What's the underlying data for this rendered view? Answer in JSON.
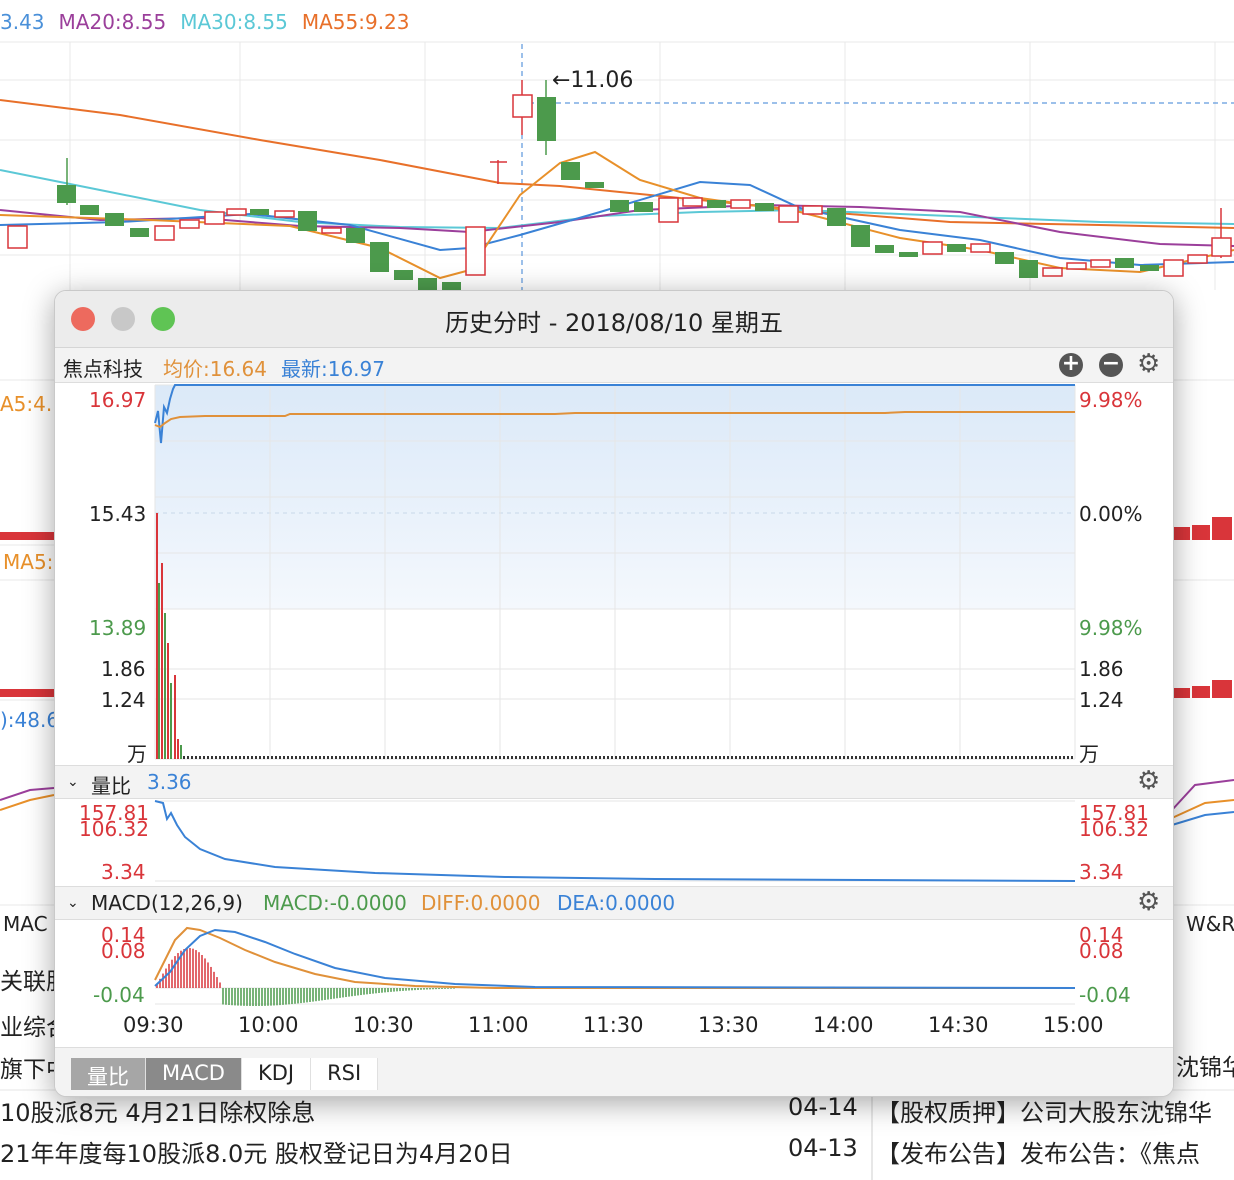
{
  "background": {
    "ma_legend": [
      {
        "text": "3.43",
        "color": "#4a90d9"
      },
      {
        "text": "MA20:8.55",
        "color": "#9b3f9b"
      },
      {
        "text": "MA30:8.55",
        "color": "#5bc8d6"
      },
      {
        "text": "MA55:9.23",
        "color": "#e8702a"
      }
    ],
    "peak_label": "←11.06",
    "left_labels": {
      "ma5_a": "A5:4.",
      "ma5_b": "MA5:",
      "val": "):48.6",
      "mac": "MAC",
      "related": "关联股",
      "industry": "业综合",
      "flag": "旗下中"
    },
    "right_labels": {
      "wr": "W&R",
      "shen": "沈锦华"
    },
    "news": [
      {
        "left": "10股派8元 4月21日除权除息",
        "date": "04-14",
        "right": "【股权质押】公司大股东沈锦华"
      },
      {
        "left": "21年年度每10股派8.0元 股权登记日为4月20日",
        "date": "04-13",
        "right": "【发布公告】发布公告：《焦点"
      }
    ],
    "candle_up_color": "#d9353a",
    "candle_down_color": "#4c9a4c"
  },
  "window": {
    "title": "历史分时 - 2018/08/10 星期五",
    "stock_name": "焦点科技",
    "avg_price": "均价:16.64",
    "latest": "最新:16.97",
    "price_axis_left": [
      "16.97",
      "15.43",
      "13.89"
    ],
    "price_axis_right": [
      "9.98%",
      "0.00%",
      "9.98%"
    ],
    "vol_axis": [
      "1.86",
      "1.24",
      "万"
    ],
    "time_axis": [
      "09:30",
      "10:00",
      "10:30",
      "11:00",
      "11:30",
      "13:30",
      "14:00",
      "14:30",
      "15:00"
    ],
    "ratio_section": {
      "label": "量比",
      "value": "3.36",
      "axis": [
        "157.81",
        "106.32",
        "3.34"
      ]
    },
    "macd_section": {
      "label": "MACD(12,26,9)",
      "macd": "MACD:-0.0000",
      "diff": "DIFF:0.0000",
      "dea": "DEA:0.0000",
      "axis": [
        "0.14",
        "0.08",
        "-0.04"
      ]
    },
    "tabs": [
      "量比",
      "MACD",
      "KDJ",
      "RSI"
    ],
    "colors": {
      "up": "#d9353a",
      "down": "#4c9a4c",
      "price": "#4a90d9",
      "avg": "#e0913a"
    }
  },
  "chart_data": {
    "type": "line",
    "title": "",
    "x": [
      "09:30",
      "10:00",
      "10:30",
      "11:00",
      "11:30",
      "13:30",
      "14:00",
      "14:30",
      "15:00"
    ],
    "series": [
      {
        "name": "最新",
        "values": [
          16.97,
          16.97,
          16.97,
          16.97,
          16.97,
          16.97,
          16.97,
          16.97,
          16.97
        ]
      },
      {
        "name": "均价",
        "values": [
          16.52,
          16.62,
          16.63,
          16.63,
          16.64,
          16.64,
          16.64,
          16.64,
          16.64
        ]
      }
    ],
    "ylim": [
      13.89,
      16.97
    ]
  }
}
